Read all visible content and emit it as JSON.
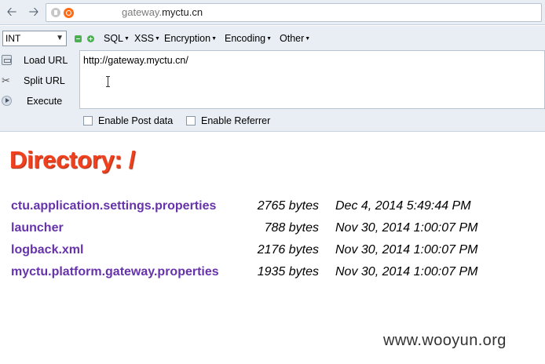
{
  "browser": {
    "url_prefix": "gateway.",
    "url_domain": "myctu.cn"
  },
  "hackbar": {
    "select_value": "INT",
    "menus": [
      "SQL",
      "XSS",
      "Encryption",
      "Encoding",
      "Other"
    ],
    "actions": {
      "load_url": "Load URL",
      "split_url": "Split URL",
      "execute": "Execute"
    },
    "textarea_value": "http://gateway.myctu.cn/",
    "checkboxes": {
      "post_data": "Enable Post data",
      "referrer": "Enable Referrer"
    }
  },
  "page": {
    "title": "Directory: /",
    "files": [
      {
        "name": "ctu.application.settings.properties",
        "size": "2765 bytes",
        "date": "Dec 4, 2014 5:49:44 PM"
      },
      {
        "name": "launcher",
        "size": "788 bytes",
        "date": "Nov 30, 2014 1:00:07 PM"
      },
      {
        "name": "logback.xml",
        "size": "2176 bytes",
        "date": "Nov 30, 2014 1:00:07 PM"
      },
      {
        "name": "myctu.platform.gateway.properties",
        "size": "1935 bytes",
        "date": "Nov 30, 2014 1:00:07 PM"
      }
    ]
  },
  "watermark": "www.wooyun.org"
}
